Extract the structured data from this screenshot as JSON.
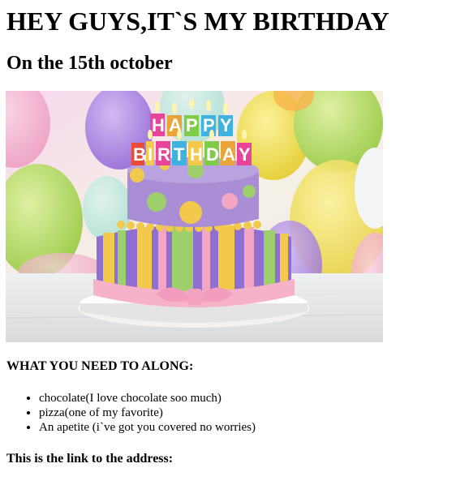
{
  "header": {
    "title": "HEY GUYS,IT`S MY BIRTHDAY",
    "subtitle": "On the 15th october"
  },
  "image": {
    "description_icon": "birthday-cake-image",
    "topper_text": "HAPPY BIRTHDAY",
    "colors": {
      "topper_h": "#e8459a",
      "topper_a": "#e9a43a",
      "topper_p1": "#7fcb4a",
      "topper_p2": "#3fb2e0",
      "topper_y": "#3fb2e0",
      "cake_top": "#a98ed6",
      "cake_bottom_stripe_purple": "#8f6fcf",
      "cake_bottom_stripe_yellow": "#f2c94b",
      "cake_bottom_stripe_green": "#9dd06a",
      "cake_bottom_stripe_pink": "#f2a6c4",
      "ribbon": "#f6b2c8",
      "balloon_yellow": "#f2e25a",
      "balloon_green": "#b6dd6a",
      "balloon_purple": "#b48be0",
      "balloon_pink": "#f3a7c7"
    }
  },
  "needs": {
    "heading": "WHAT YOU NEED TO ALONG:",
    "items": [
      "chocolate(I love chocolate soo much)",
      "pizza(one of my favorite)",
      "An apetite (i`ve got you covered no worries)"
    ]
  },
  "address": {
    "heading": "This is the link to the address:"
  }
}
